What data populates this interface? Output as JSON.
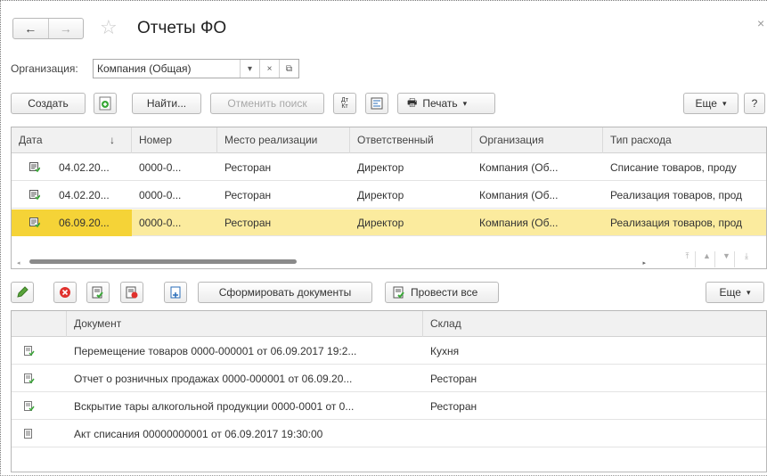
{
  "window": {
    "title": "Отчеты ФО"
  },
  "filter": {
    "org_label": "Организация:",
    "org_value": "Компания (Общая)"
  },
  "toolbar": {
    "create": "Создать",
    "find": "Найти...",
    "cancel_search": "Отменить поиск",
    "dt_kt": "Дт Кт",
    "print": "Печать",
    "more": "Еще",
    "help": "?"
  },
  "table": {
    "columns": [
      "Дата",
      "Номер",
      "Место реализации",
      "Ответственный",
      "Организация",
      "Тип расхода"
    ],
    "sort_icon": "↓",
    "rows": [
      [
        "04.02.20...",
        "0000-0...",
        "Ресторан",
        "Директор",
        "Компания (Об...",
        "Списание товаров, проду"
      ],
      [
        "04.02.20...",
        "0000-0...",
        "Ресторан",
        "Директор",
        "Компания (Об...",
        "Реализация товаров, прод"
      ],
      [
        "06.09.20...",
        "0000-0...",
        "Ресторан",
        "Директор",
        "Компания (Об...",
        "Реализация товаров, прод"
      ]
    ]
  },
  "subtoolbar": {
    "form_docs": "Сформировать документы",
    "post_all": "Провести все",
    "more": "Еще"
  },
  "subtable": {
    "columns": [
      "Документ",
      "Склад"
    ],
    "rows": [
      [
        "Перемещение товаров 0000-000001 от 06.09.2017 19:2...",
        "Кухня"
      ],
      [
        "Отчет о розничных продажах 0000-000001 от 06.09.20...",
        "Ресторан"
      ],
      [
        "Вскрытие тары алкогольной продукции 0000-0001 от 0...",
        "Ресторан"
      ],
      [
        "Акт списания 00000000001 от 06.09.2017 19:30:00",
        ""
      ]
    ]
  },
  "colors": {
    "selected_row": "#fbeb9e",
    "selected_cell": "#f5d337"
  }
}
